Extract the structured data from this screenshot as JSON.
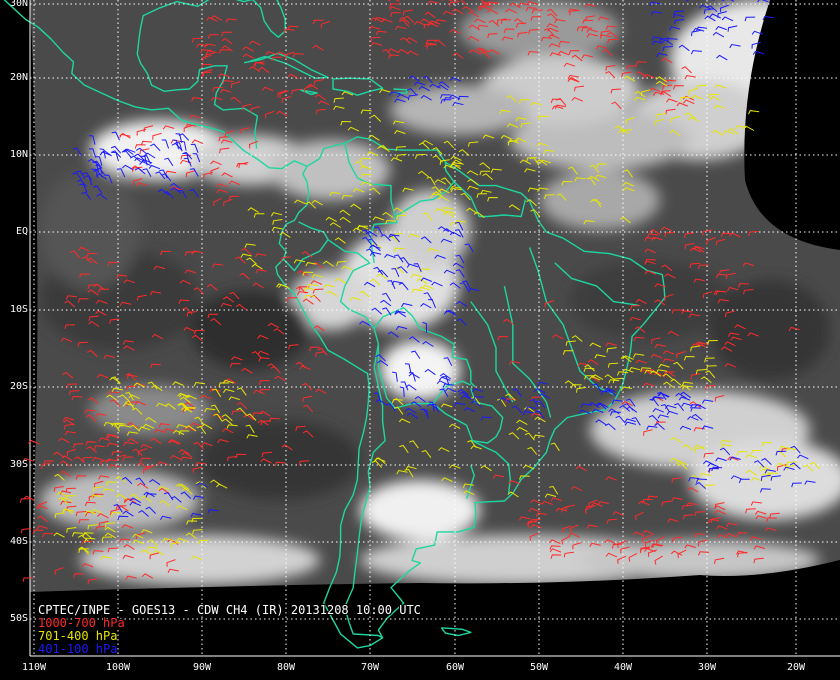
{
  "title": "CPTEC/INPE - GOES13 - CDW CH4 (IR) 20131208 10:00 UTC",
  "legend": [
    {
      "label": "1000-700 hPa",
      "color": "#ff2a2a"
    },
    {
      "label": "701-400 hPa",
      "color": "#e6e600"
    },
    {
      "label": "401-100 hPa",
      "color": "#1a1aff"
    }
  ],
  "lat_labels": [
    "30N",
    "20N",
    "10N",
    "EQ",
    "10S",
    "20S",
    "30S",
    "40S",
    "50S"
  ],
  "lon_labels": [
    "110W",
    "100W",
    "90W",
    "80W",
    "70W",
    "60W",
    "50W",
    "40W",
    "30W",
    "20W"
  ],
  "colors": {
    "coastline": "#1ed6a0",
    "grid": "#ffffff",
    "background": "#000000"
  }
}
